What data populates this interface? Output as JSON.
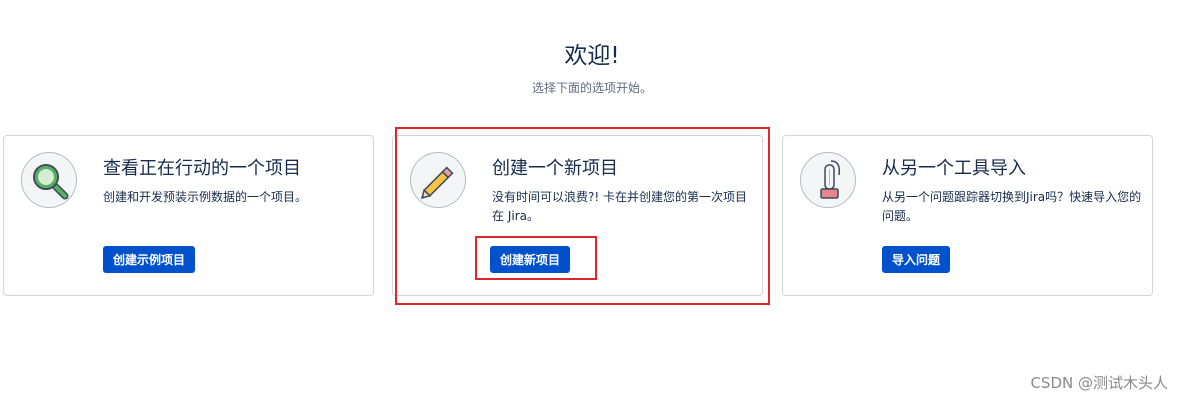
{
  "header": {
    "title": "欢迎!",
    "subtitle": "选择下面的选项开始。"
  },
  "cards": [
    {
      "icon": "magnifier-icon",
      "title": "查看正在行动的一个项目",
      "description": "创建和开发预装示例数据的一个项目。",
      "button_label": "创建示例项目"
    },
    {
      "icon": "pencil-icon",
      "title": "创建一个新项目",
      "description": "没有时间可以浪费?! 卡在并创建您的第一次项目在 Jira。",
      "button_label": "创建新项目"
    },
    {
      "icon": "vacuum-icon",
      "title": "从另一个工具导入",
      "description": "从另一个问题跟踪器切换到Jira吗？快速导入您的问题。",
      "button_label": "导入问题"
    }
  ],
  "colors": {
    "primary_button": "#0052cc",
    "highlight": "#e0262b"
  },
  "watermark": "CSDN @测试木头人"
}
